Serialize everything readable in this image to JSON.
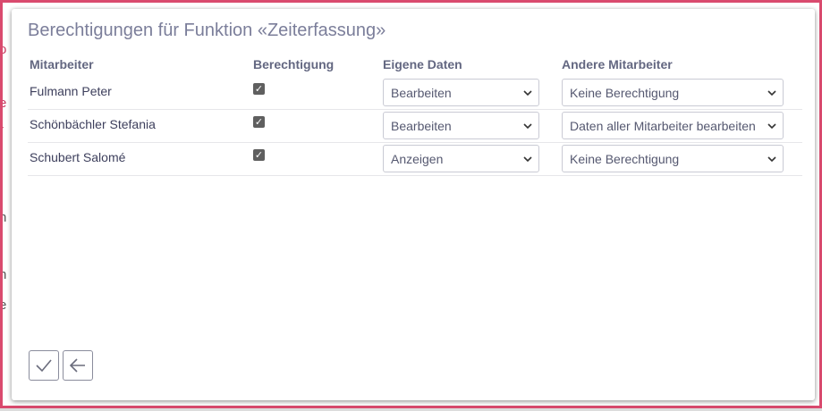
{
  "dialog": {
    "title": "Berechtigungen für Funktion «Zeiterfassung»"
  },
  "columns": {
    "employee": "Mitarbeiter",
    "permission": "Berechtigung",
    "own_data": "Eigene Daten",
    "other_employees": "Andere Mitarbeiter"
  },
  "rows": [
    {
      "name": "Fulmann Peter",
      "checked": true,
      "own_data": "Bearbeiten",
      "other_employees": "Keine Berechtigung"
    },
    {
      "name": "Schönbächler Stefania",
      "checked": true,
      "own_data": "Bearbeiten",
      "other_employees": "Daten aller Mitarbeiter bearbeiten"
    },
    {
      "name": "Schubert Salomé",
      "checked": true,
      "own_data": "Anzeigen",
      "other_employees": "Keine Berechtigung"
    }
  ],
  "icons": {
    "confirm": "checkmark-icon",
    "back": "arrow-left-icon",
    "dropdown": "chevron-down-icon",
    "checkbox": "checkbox-checked-icon"
  },
  "colors": {
    "frame_border": "#d94a6e",
    "title": "#7b7e9a",
    "header": "#636781",
    "text": "#3d3f5c",
    "checkbox": "#5f5f5f"
  }
}
